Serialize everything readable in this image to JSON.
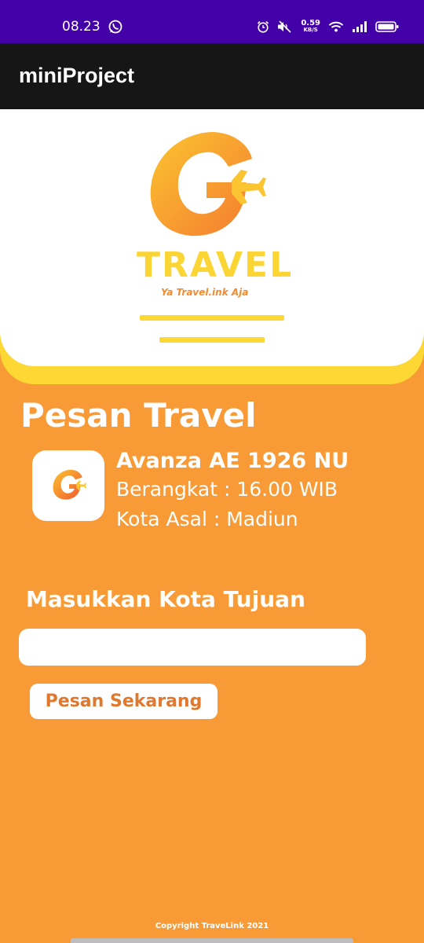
{
  "status_bar": {
    "time": "08.23",
    "network_speed": "0.59",
    "network_unit": "KB/S",
    "icons": [
      "whatsapp-icon",
      "alarm-icon",
      "mute-icon",
      "wifi-icon",
      "signal-icon",
      "battery-icon"
    ],
    "background_color": "#4400a8"
  },
  "app_bar": {
    "title": "miniProject",
    "background_color": "#161616"
  },
  "header": {
    "logo_word": "TRAVEL",
    "logo_tagline": "Ya Travel.ink Aja",
    "brand_colors": {
      "yellow": "#fdd835",
      "orange": "#f58b2f"
    }
  },
  "booking": {
    "title": "Pesan Travel",
    "vehicle_name": "Avanza AE 1926 NU",
    "departure": "Berangkat : 16.00 WIB",
    "origin": "Kota Asal : Madiun",
    "destination_label": "Masukkan Kota Tujuan",
    "destination_value": "",
    "destination_placeholder": "",
    "order_button_label": "Pesan Sekarang",
    "background_color": "#f89b36"
  },
  "footer": {
    "copyright": "Copyright TraveLink 2021"
  }
}
